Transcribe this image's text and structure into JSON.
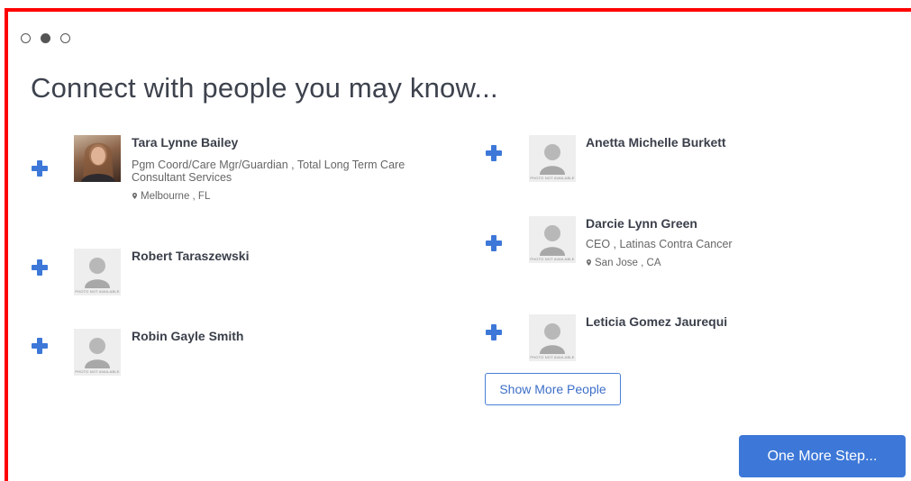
{
  "stepper": {
    "total": 3,
    "active_index": 1
  },
  "title": "Connect with people you may know...",
  "placeholder_photo_caption": "PHOTO NOT AVAILABLE",
  "people": [
    {
      "name": "Tara Lynne Bailey",
      "role": "Pgm Coord/Care Mgr/Guardian , Total Long Term Care Consultant Services",
      "location": "Melbourne , FL",
      "has_photo": true
    },
    {
      "name": "Robert Taraszewski",
      "role": "",
      "location": "",
      "has_photo": false
    },
    {
      "name": "Robin Gayle Smith",
      "role": "",
      "location": "",
      "has_photo": false
    },
    {
      "name": "Anetta Michelle Burkett",
      "role": "",
      "location": "",
      "has_photo": false
    },
    {
      "name": "Darcie Lynn Green",
      "role": "CEO , Latinas Contra Cancer",
      "location": "San Jose , CA",
      "has_photo": false
    },
    {
      "name": "Leticia Gomez Jaurequi",
      "role": "",
      "location": "",
      "has_photo": false
    }
  ],
  "show_more_label": "Show More People",
  "next_label": "One More Step...",
  "colors": {
    "accent": "#3d78d8",
    "frame": "#ff0000",
    "text": "#3a3f4a"
  },
  "icons": {
    "add": "plus-icon",
    "location": "map-marker-icon",
    "stepper": "circle-dot-icon"
  }
}
